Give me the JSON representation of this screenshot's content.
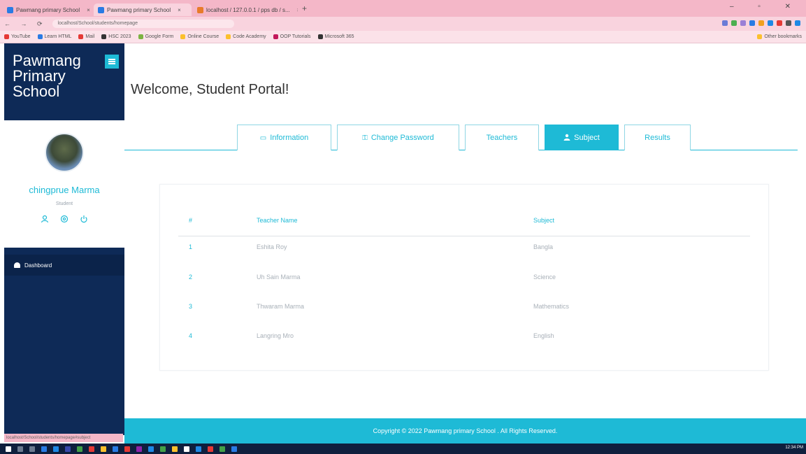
{
  "browser": {
    "tabs": [
      {
        "label": "Pawmang primary School",
        "active": false
      },
      {
        "label": "Pawmang primary School",
        "active": true
      },
      {
        "label": "localhost / 127.0.0.1 / pps db / s...",
        "active": false
      }
    ],
    "new_tab": "+",
    "url": "localhost/School/students/homepage",
    "bookmarks": [
      "YouTube",
      "Learn HTML",
      "Mail",
      "HSC 2023",
      "Google Form",
      "Online Course",
      "Code Academy",
      "OOP Tutorials",
      "Microsoft 365",
      "Other bookmarks"
    ],
    "status_url": "localhost/School/students/homepage#subject"
  },
  "sidebar": {
    "brand": "Pawmang Primary School",
    "profile": {
      "name": "chingprue Marma",
      "role": "Student"
    },
    "nav": [
      {
        "label": "Dashboard"
      }
    ]
  },
  "main": {
    "title": "Welcome, Student Portal!",
    "tabs": [
      {
        "label": "Information",
        "icon": "card-icon",
        "active": false
      },
      {
        "label": "Change Password",
        "icon": "key-icon",
        "active": false
      },
      {
        "label": "Teachers",
        "icon": "",
        "active": false
      },
      {
        "label": "Subject",
        "icon": "user-icon",
        "active": true
      },
      {
        "label": "Results",
        "icon": "",
        "active": false
      }
    ],
    "table": {
      "columns": [
        "#",
        "Teacher Name",
        "Subject"
      ],
      "rows": [
        {
          "num": "1",
          "teacher": "Eshita Roy",
          "subject": "Bangla"
        },
        {
          "num": "2",
          "teacher": "Uh Sain Marma",
          "subject": "Science"
        },
        {
          "num": "3",
          "teacher": "Thwaram Marma",
          "subject": "Mathematics"
        },
        {
          "num": "4",
          "teacher": "Langring Mro",
          "subject": "English"
        }
      ]
    }
  },
  "footer": {
    "text": "Copyright © 2022 Pawmang primary School . All Rights Reserved."
  },
  "taskbar": {
    "clock": "12:34 PM"
  },
  "colors": {
    "accent": "#1ebad6",
    "sidebar": "#0e2a57",
    "chrome": "#f4b7c8"
  }
}
